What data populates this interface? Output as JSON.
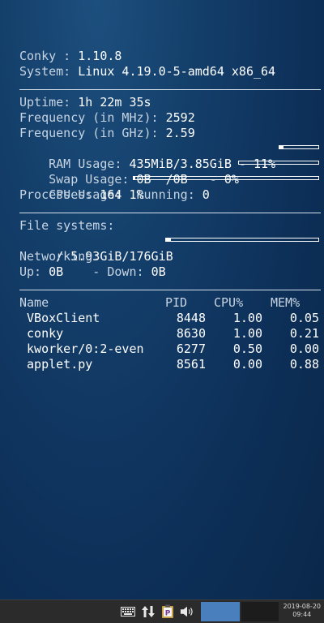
{
  "conky": {
    "version_label": "Conky : ",
    "version_value": "1.10.8",
    "system_label": "System: ",
    "system_value": "Linux 4.19.0-5-amd64 x86_64",
    "uptime_label": "Uptime: ",
    "uptime_value": "1h 22m 35s",
    "freq_mhz_label": "Frequency (in MHz): ",
    "freq_mhz_value": "2592",
    "freq_ghz_label": "Frequency (in GHz): ",
    "freq_ghz_value": "2.59",
    "ram_label": "RAM Usage: ",
    "ram_value": "435MiB/3.85GiB - 11%",
    "ram_fraction": 0.11,
    "swap_label": "Swap Usage: ",
    "swap_value": "0B  /0B   - 0%",
    "swap_fraction": 0.0,
    "cpu_label": "CPU Usage: ",
    "cpu_value": "1%",
    "cpu_fraction": 0.01,
    "processes_label": "Processes: ",
    "processes_value": "164",
    "running_label": "  Running: ",
    "running_value": "0",
    "fs_label": "File systems:",
    "fs_root_value": " / 5.93GiB/176GiB",
    "fs_root_fraction": 0.034,
    "net_label": "Networking:",
    "up_label": "Up: ",
    "up_value": "0B",
    "down_label": "    - Down: ",
    "down_value": "0B"
  },
  "process_table": {
    "headers": [
      "Name",
      "PID",
      "CPU%",
      "MEM%"
    ],
    "rows": [
      [
        " VBoxClient",
        "8448",
        "1.00",
        "0.05"
      ],
      [
        " conky",
        "8630",
        "1.00",
        "0.21"
      ],
      [
        " kworker/0:2-even",
        "6277",
        "0.50",
        "0.00"
      ],
      [
        " applet.py",
        "8561",
        "0.00",
        "0.88"
      ]
    ]
  },
  "taskbar": {
    "icons": [
      "keyboard-icon",
      "network-arrows-icon",
      "clipboard-icon",
      "volume-icon"
    ],
    "clipboard_glyph": "P",
    "clock_date": "2019-08-20",
    "clock_time": "09:44"
  }
}
